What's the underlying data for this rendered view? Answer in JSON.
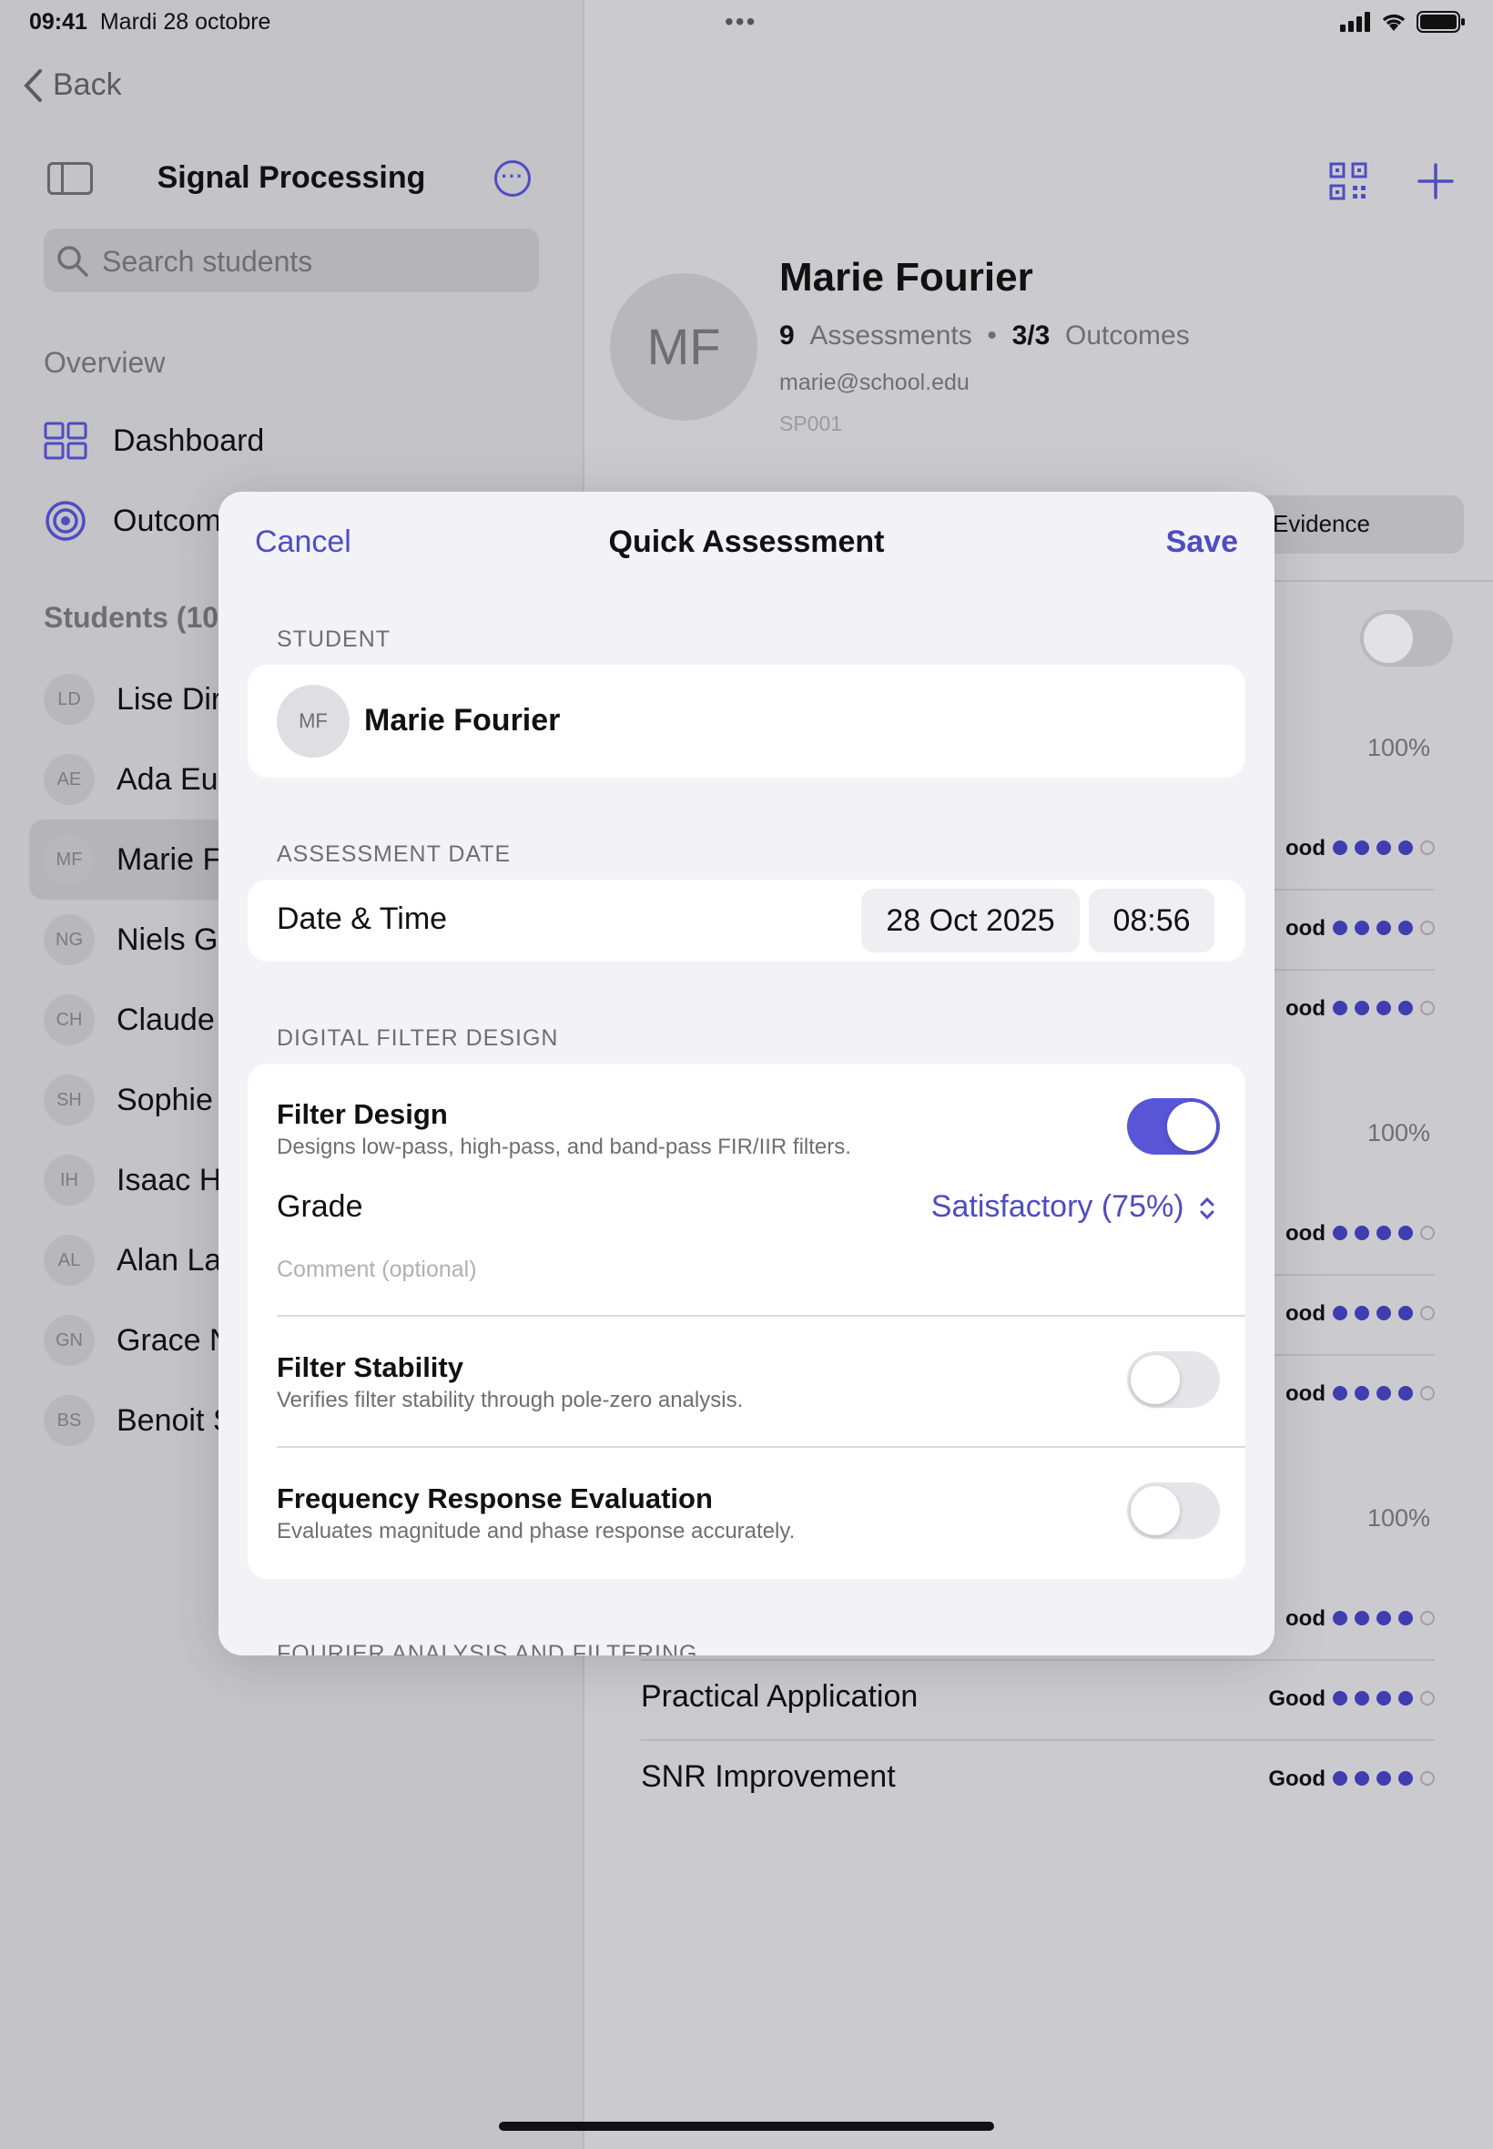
{
  "status_bar": {
    "time": "09:41",
    "date": "Mardi 28 octobre"
  },
  "sidebar": {
    "back_label": "Back",
    "title": "Signal Processing",
    "search_placeholder": "Search students",
    "overview_label": "Overview",
    "nav": [
      {
        "label": "Dashboard",
        "icon": "grid-icon"
      },
      {
        "label": "Outcom",
        "icon": "target-icon"
      }
    ],
    "students_label": "Students (10",
    "students": [
      {
        "initials": "LD",
        "name": "Lise Diri"
      },
      {
        "initials": "AE",
        "name": "Ada Eule"
      },
      {
        "initials": "MF",
        "name": "Marie F"
      },
      {
        "initials": "NG",
        "name": "Niels Ga"
      },
      {
        "initials": "CH",
        "name": "Claude"
      },
      {
        "initials": "SH",
        "name": "Sophie"
      },
      {
        "initials": "IH",
        "name": "Isaac Hi"
      },
      {
        "initials": "AL",
        "name": "Alan Lap"
      },
      {
        "initials": "GN",
        "name": "Grace N"
      },
      {
        "initials": "BS",
        "name": "Benoit S"
      }
    ]
  },
  "profile": {
    "initials": "MF",
    "name": "Marie Fourier",
    "assessments_count": "9",
    "assessments_label": "Assessments",
    "separator": "•",
    "outcomes_count": "3/3",
    "outcomes_label": "Outcomes",
    "email": "marie@school.edu",
    "student_id": "SP001",
    "segment_label": "Evidence"
  },
  "outcome_rows": {
    "percents": [
      "100%",
      "100%",
      "100%"
    ],
    "grade_label": "Good",
    "partial_grade_label": "ood",
    "visible_labels": [
      "Practical Application",
      "SNR Improvement"
    ],
    "dots_filled": 4,
    "dots_total": 5
  },
  "modal": {
    "cancel_label": "Cancel",
    "title": "Quick Assessment",
    "save_label": "Save",
    "student_section": "STUDENT",
    "student_initials": "MF",
    "student_name": "Marie Fourier",
    "date_section": "ASSESSMENT DATE",
    "date_time_label": "Date & Time",
    "date_value": "28 Oct 2025",
    "time_value": "08:56",
    "filter_section": "DIGITAL FILTER DESIGN",
    "criteria": [
      {
        "title": "Filter Design",
        "description": "Designs low-pass, high-pass, and band-pass FIR/IIR filters.",
        "enabled": true
      },
      {
        "title": "Filter Stability",
        "description": "Verifies filter stability through pole-zero analysis.",
        "enabled": false
      },
      {
        "title": "Frequency Response Evaluation",
        "description": "Evaluates magnitude and phase response accurately.",
        "enabled": false
      }
    ],
    "grade_label": "Grade",
    "grade_value": "Satisfactory (75%)",
    "comment_placeholder": "Comment (optional)",
    "next_section_peek": "FOURIER ANALYSIS AND FILTERING"
  },
  "colors": {
    "accent": "#5856d6",
    "link": "#4f4cc2",
    "dot_fill": "#3f3db0"
  }
}
